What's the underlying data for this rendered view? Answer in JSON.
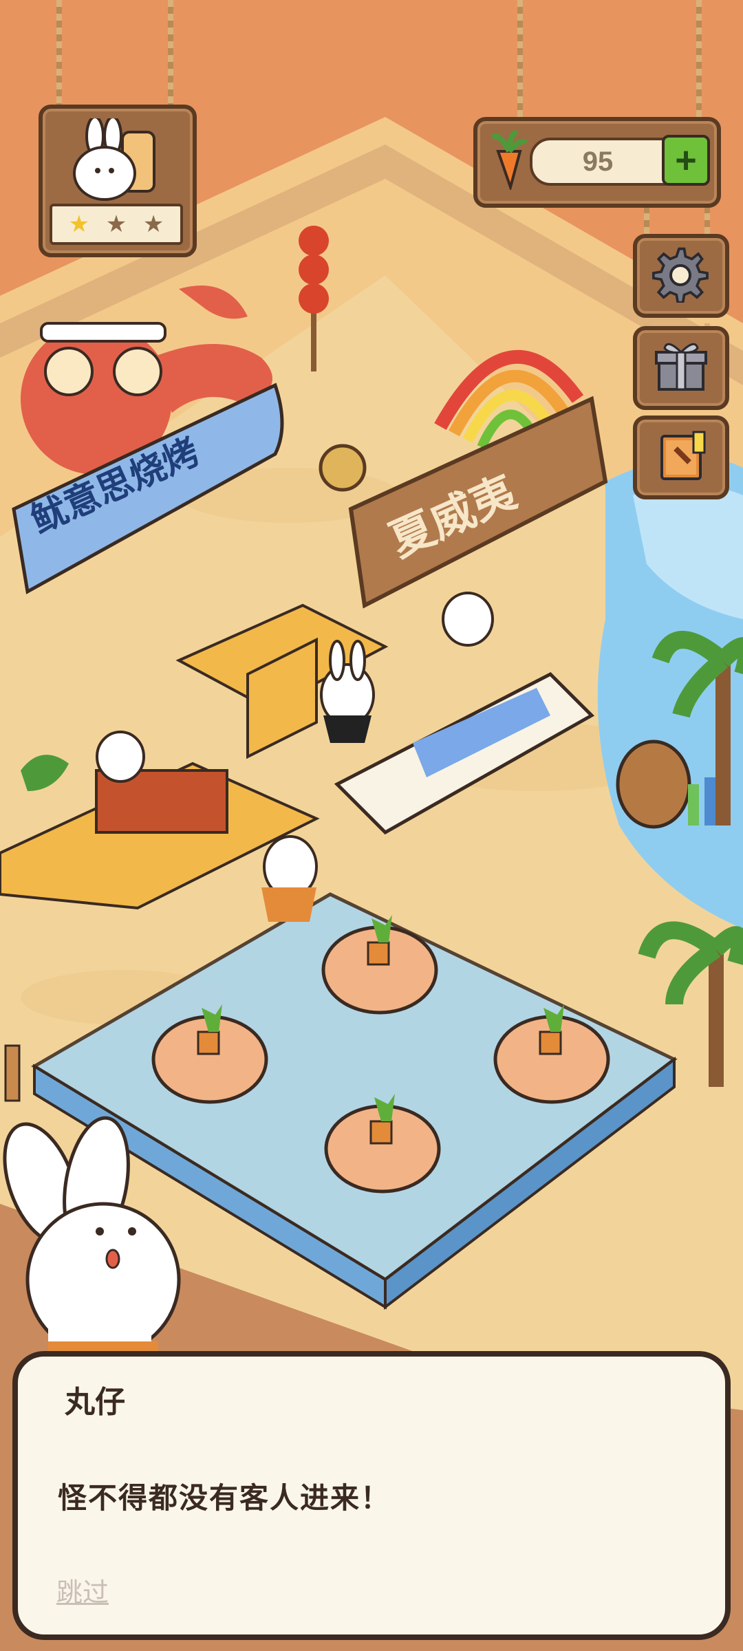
{
  "hud": {
    "carrot_count": "95",
    "plus_label": "+",
    "rating_stars": 1,
    "rating_max": 3
  },
  "signs": {
    "octopus_banner": "鱿意思烧烤",
    "shop_sign": "夏威夷"
  },
  "side_buttons": [
    {
      "icon": "gear-icon",
      "name": "settings-button"
    },
    {
      "icon": "gift-icon",
      "name": "gift-button"
    },
    {
      "icon": "recipe-book-icon",
      "name": "menu-book-button"
    }
  ],
  "dialog": {
    "speaker": "丸仔",
    "text": "怪不得都没有客人进来！",
    "skip_label": "跳过"
  },
  "colors": {
    "wall": "#e8945f",
    "sand": "#f2d49a",
    "water": "#6fb6e6",
    "wood": "#9c6b44",
    "dialog_bg": "#fbf6ea",
    "accent_green": "#6fc13a"
  }
}
